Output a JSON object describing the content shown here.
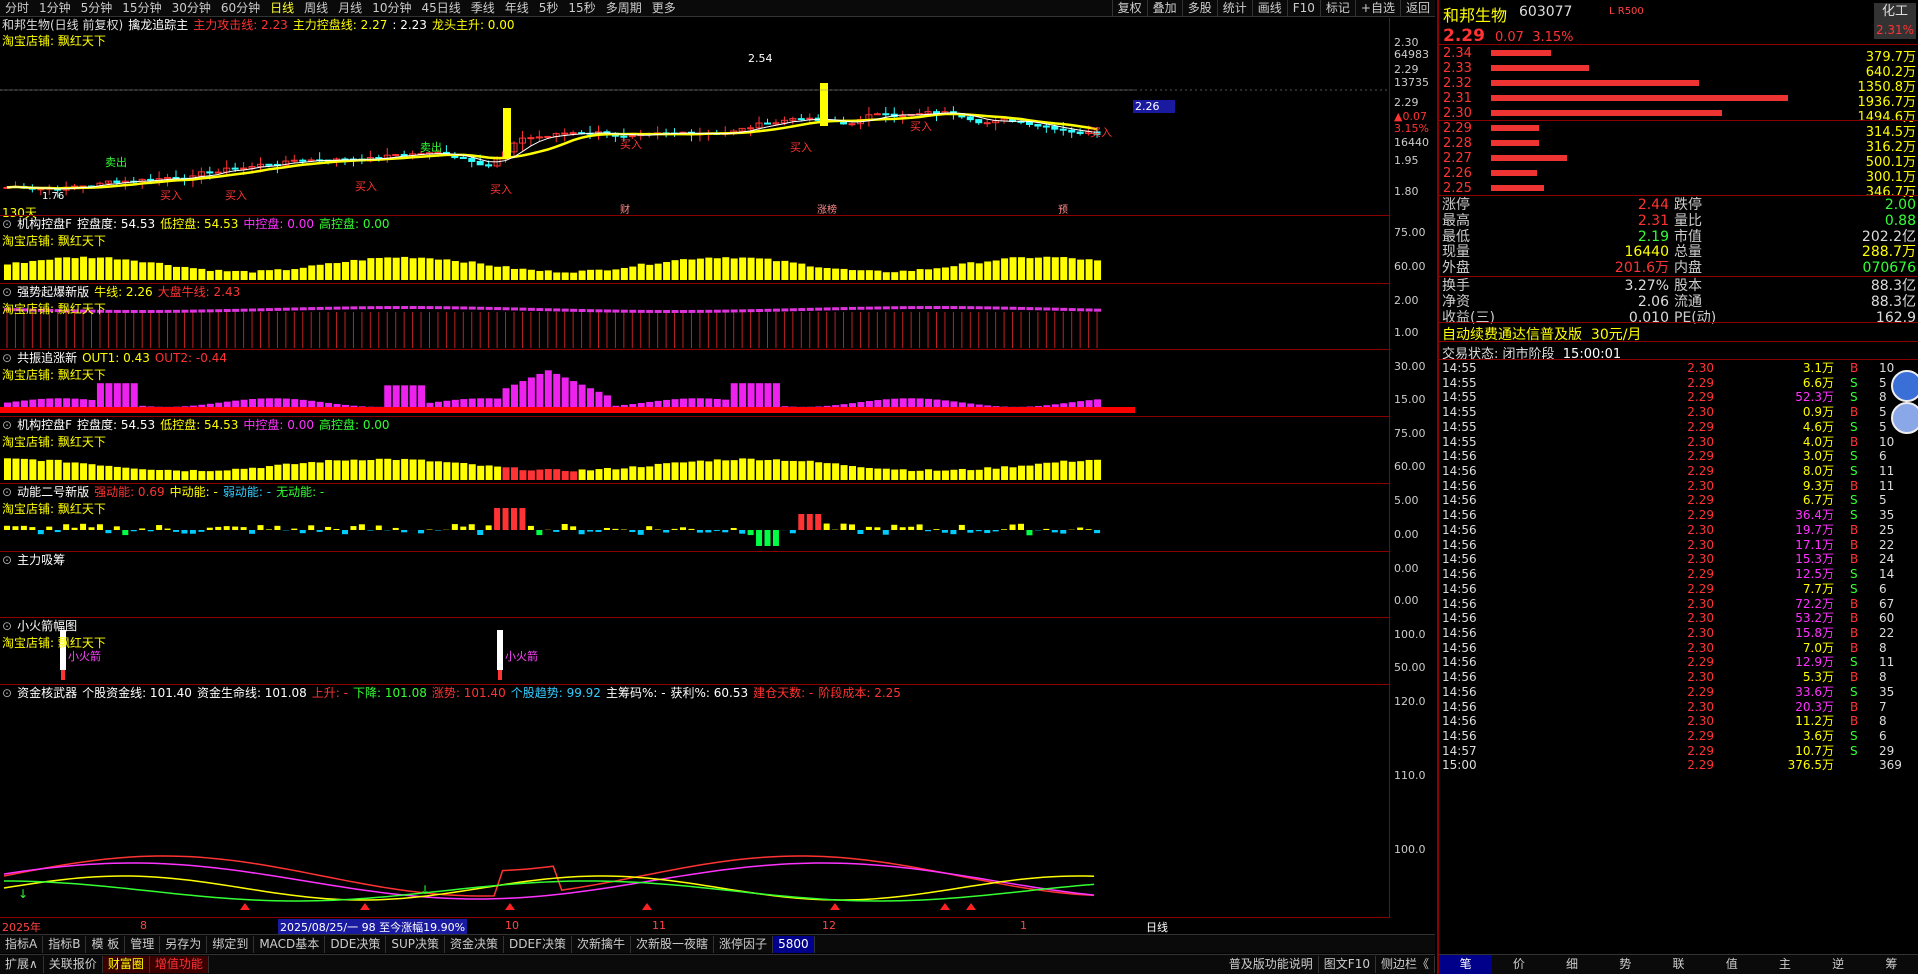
{
  "topbar": {
    "periods": [
      "分时",
      "1分钟",
      "5分钟",
      "15分钟",
      "30分钟",
      "60分钟",
      "日线",
      "周线",
      "月线",
      "10分钟",
      "45日线",
      "季线",
      "年线",
      "5秒",
      "15秒",
      "多周期",
      "更多"
    ],
    "active_period": "日线",
    "tools": [
      "复权",
      "叠加",
      "多股",
      "统计",
      "画线",
      "F10",
      "标记",
      "+自选",
      "返回"
    ]
  },
  "main": {
    "title": "和邦生物(日线 前复权)",
    "indicator": "擒龙追踪主",
    "fields": [
      {
        "label": "主力攻击线: 2.23",
        "color": "#ff3333"
      },
      {
        "label": "主力控盘线: 2.27",
        "color": "#ffff00"
      },
      {
        "label": ": 2.23",
        "color": "#ffffff"
      },
      {
        "label": "龙头主升: 0.00",
        "color": "#ffff00"
      }
    ],
    "note": "淘宝店铺: 飘红天下",
    "high_label": "2.54",
    "low_label": "1.76",
    "days_label": "130天",
    "price_tag": "2.26",
    "markers": [
      "卖出",
      "卖出",
      "买入",
      "买入",
      "买入",
      "买入",
      "买入",
      "买入",
      "买入",
      "买入"
    ],
    "event_tags": [
      "财",
      "涨榜",
      "预"
    ],
    "y_labels": [
      "2.30",
      "64983",
      "2.29",
      "13735",
      "2.29",
      "▲0.07",
      "3.15%",
      "16440",
      "1.95",
      "1.80"
    ]
  },
  "panels": [
    {
      "title": "机构控盘F",
      "fields": [
        {
          "label": "控盘度: 54.53",
          "color": "#ffffff"
        },
        {
          "label": "低控盘: 54.53",
          "color": "#ffff00"
        },
        {
          "label": "中控盘: 0.00",
          "color": "#ff33ff"
        },
        {
          "label": "高控盘: 0.00",
          "color": "#33ff33"
        }
      ],
      "note": "淘宝店铺: 飘红天下",
      "y": [
        "75.00",
        "60.00"
      ]
    },
    {
      "title": "强势起爆新版",
      "fields": [
        {
          "label": "牛线: 2.26",
          "color": "#ffff00"
        },
        {
          "label": "大盘牛线: 2.43",
          "color": "#ff3333"
        }
      ],
      "note": "淘宝店铺: 飘红天下",
      "y": [
        "2.00",
        "1.00"
      ]
    },
    {
      "title": "共振追涨新",
      "fields": [
        {
          "label": "OUT1: 0.43",
          "color": "#ffff00"
        },
        {
          "label": "OUT2: -0.44",
          "color": "#ff3333"
        }
      ],
      "note": "淘宝店铺: 飘红天下",
      "y": [
        "30.00",
        "15.00"
      ]
    },
    {
      "title": "机构控盘F",
      "fields": [
        {
          "label": "控盘度: 54.53",
          "color": "#ffffff"
        },
        {
          "label": "低控盘: 54.53",
          "color": "#ffff00"
        },
        {
          "label": "中控盘: 0.00",
          "color": "#ff33ff"
        },
        {
          "label": "高控盘: 0.00",
          "color": "#33ff33"
        }
      ],
      "note": "淘宝店铺: 飘红天下",
      "y": [
        "75.00",
        "60.00"
      ]
    },
    {
      "title": "动能二号新版",
      "fields": [
        {
          "label": "强动能: 0.69",
          "color": "#ff3333"
        },
        {
          "label": "中动能: -",
          "color": "#ffff00"
        },
        {
          "label": "弱动能: -",
          "color": "#33ccff"
        },
        {
          "label": "无动能: -",
          "color": "#33ff33"
        }
      ],
      "note": "淘宝店铺: 飘红天下",
      "y": [
        "5.00",
        "0.00"
      ]
    },
    {
      "title": "主力吸筹",
      "fields": [],
      "note": "",
      "y": [
        "0.00",
        "0.00"
      ]
    },
    {
      "title": "小火箭幅图",
      "fields": [],
      "note": "淘宝店铺: 飘红天下",
      "y": [
        "100.0",
        "50.00"
      ],
      "rocket": "小火箭"
    },
    {
      "title": "资金核武器",
      "fields": [
        {
          "label": "个股资金线: 101.40",
          "color": "#ffffff"
        },
        {
          "label": "资金生命线: 101.08",
          "color": "#ffffff"
        },
        {
          "label": "上升: -",
          "color": "#ff3333"
        },
        {
          "label": "下降: 101.08",
          "color": "#33ff33"
        },
        {
          "label": "涨势: 101.40",
          "color": "#ff3333"
        },
        {
          "label": "个股趋势: 99.92",
          "color": "#33ccff"
        },
        {
          "label": "主筹码%: -",
          "color": "#ffffff"
        },
        {
          "label": "获利%: 60.53",
          "color": "#ffffff"
        },
        {
          "label": "建仓天数: -",
          "color": "#ff3333"
        },
        {
          "label": "阶段成本: 2.25",
          "color": "#ff3333"
        }
      ],
      "note": "",
      "y": [
        "120.0",
        "110.0",
        "100.0"
      ]
    }
  ],
  "datebar": {
    "labels": [
      "2025年",
      "8",
      "10",
      "11",
      "12",
      "1"
    ],
    "highlight": "2025/08/25/一 98 至今涨幅19.90%",
    "right": "日线"
  },
  "bottombar1": [
    "指标A",
    "指标B",
    "模 板",
    "管理",
    "另存为",
    "绑定到",
    "MACD基本",
    "DDE决策",
    "SUP决策",
    "资金决策",
    "DDEF决策",
    "次新擒牛",
    "次新股一夜瞎",
    "涨停因子",
    "5800"
  ],
  "bottombar2": [
    "扩展∧",
    "关联报价",
    "财富圈",
    "增值功能"
  ],
  "bottom_right": [
    "普及版功能说明",
    "图文F10",
    "侧边栏《"
  ],
  "stock": {
    "name": "和邦生物",
    "code": "603077",
    "tag": "L R500",
    "price": "2.29",
    "change": "0.07",
    "pct": "3.15%",
    "industry": "化工",
    "industry_pct": "2.31%"
  },
  "asks": [
    {
      "p": "2.34",
      "v": "379.7万",
      "w": 72
    },
    {
      "p": "2.33",
      "v": "640.2万",
      "w": 118
    },
    {
      "p": "2.32",
      "v": "1350.8万",
      "w": 250
    },
    {
      "p": "2.31",
      "v": "1936.7万",
      "w": 358
    },
    {
      "p": "2.30",
      "v": "1494.6万",
      "w": 278
    }
  ],
  "bids": [
    {
      "p": "2.29",
      "v": "314.5万",
      "w": 58
    },
    {
      "p": "2.28",
      "v": "316.2万",
      "w": 58
    },
    {
      "p": "2.27",
      "v": "500.1万",
      "w": 92
    },
    {
      "p": "2.26",
      "v": "300.1万",
      "w": 55
    },
    {
      "p": "2.25",
      "v": "346.7万",
      "w": 64
    }
  ],
  "stats": [
    {
      "k1": "涨停",
      "v1": "2.44",
      "c1": "#ff3333",
      "k2": "跌停",
      "v2": "2.00",
      "c2": "#33ff33"
    },
    {
      "k1": "最高",
      "v1": "2.31",
      "c1": "#ff3333",
      "k2": "量比",
      "v2": "0.88",
      "c2": "#33ff33"
    },
    {
      "k1": "最低",
      "v1": "2.19",
      "c1": "#33ff33",
      "k2": "市值",
      "v2": "202.2亿",
      "c2": "#dddddd"
    },
    {
      "k1": "现量",
      "v1": "16440",
      "c1": "#ffff00",
      "k2": "总量",
      "v2": "288.7万",
      "c2": "#ffff00"
    },
    {
      "k1": "外盘",
      "v1": "201.6万",
      "c1": "#ff3333",
      "k2": "内盘",
      "v2": "070676",
      "c2": "#33ff33"
    },
    {
      "k1": "换手",
      "v1": "3.27%",
      "c1": "#dddddd",
      "k2": "股本",
      "v2": "88.3亿",
      "c2": "#dddddd"
    },
    {
      "k1": "净资",
      "v1": "2.06",
      "c1": "#dddddd",
      "k2": "流通",
      "v2": "88.3亿",
      "c2": "#dddddd"
    },
    {
      "k1": "收益(三)",
      "v1": "0.010",
      "c1": "#dddddd",
      "k2": "PE(动)",
      "v2": "162.9",
      "c2": "#dddddd"
    }
  ],
  "promo": {
    "text": "自动续费通达信普及版",
    "price": "30元/月"
  },
  "trade_status": {
    "label": "交易状态: 闭市阶段",
    "time": "15:00:01"
  },
  "ticks": [
    {
      "t": "14:55",
      "p": "2.30",
      "v": "3.1万",
      "vc": "#ffff00",
      "bs": "B",
      "n": "10"
    },
    {
      "t": "14:55",
      "p": "2.29",
      "v": "6.6万",
      "vc": "#ffff00",
      "bs": "S",
      "n": "5"
    },
    {
      "t": "14:55",
      "p": "2.29",
      "v": "52.3万",
      "vc": "#ff33ff",
      "bs": "S",
      "n": "8"
    },
    {
      "t": "14:55",
      "p": "2.30",
      "v": "0.9万",
      "vc": "#ffff00",
      "bs": "B",
      "n": "5"
    },
    {
      "t": "14:55",
      "p": "2.29",
      "v": "4.6万",
      "vc": "#ffff00",
      "bs": "S",
      "n": "5"
    },
    {
      "t": "14:55",
      "p": "2.30",
      "v": "4.0万",
      "vc": "#ffff00",
      "bs": "B",
      "n": "10"
    },
    {
      "t": "14:56",
      "p": "2.29",
      "v": "3.0万",
      "vc": "#ffff00",
      "bs": "S",
      "n": "6"
    },
    {
      "t": "14:56",
      "p": "2.29",
      "v": "8.0万",
      "vc": "#ffff00",
      "bs": "S",
      "n": "11"
    },
    {
      "t": "14:56",
      "p": "2.30",
      "v": "9.3万",
      "vc": "#ffff00",
      "bs": "B",
      "n": "11"
    },
    {
      "t": "14:56",
      "p": "2.29",
      "v": "6.7万",
      "vc": "#ffff00",
      "bs": "S",
      "n": "5"
    },
    {
      "t": "14:56",
      "p": "2.29",
      "v": "36.4万",
      "vc": "#ff33ff",
      "bs": "S",
      "n": "35"
    },
    {
      "t": "14:56",
      "p": "2.30",
      "v": "19.7万",
      "vc": "#ff33ff",
      "bs": "B",
      "n": "25"
    },
    {
      "t": "14:56",
      "p": "2.30",
      "v": "17.1万",
      "vc": "#ff33ff",
      "bs": "B",
      "n": "22"
    },
    {
      "t": "14:56",
      "p": "2.30",
      "v": "15.3万",
      "vc": "#ff33ff",
      "bs": "B",
      "n": "24"
    },
    {
      "t": "14:56",
      "p": "2.29",
      "v": "12.5万",
      "vc": "#ff33ff",
      "bs": "S",
      "n": "14"
    },
    {
      "t": "14:56",
      "p": "2.29",
      "v": "7.7万",
      "vc": "#ffff00",
      "bs": "S",
      "n": "6"
    },
    {
      "t": "14:56",
      "p": "2.30",
      "v": "72.2万",
      "vc": "#ff33ff",
      "bs": "B",
      "n": "67"
    },
    {
      "t": "14:56",
      "p": "2.30",
      "v": "53.2万",
      "vc": "#ff33ff",
      "bs": "B",
      "n": "60"
    },
    {
      "t": "14:56",
      "p": "2.30",
      "v": "15.8万",
      "vc": "#ff33ff",
      "bs": "B",
      "n": "22"
    },
    {
      "t": "14:56",
      "p": "2.30",
      "v": "7.0万",
      "vc": "#ffff00",
      "bs": "B",
      "n": "8"
    },
    {
      "t": "14:56",
      "p": "2.29",
      "v": "12.9万",
      "vc": "#ff33ff",
      "bs": "S",
      "n": "11"
    },
    {
      "t": "14:56",
      "p": "2.30",
      "v": "5.3万",
      "vc": "#ffff00",
      "bs": "B",
      "n": "8"
    },
    {
      "t": "14:56",
      "p": "2.29",
      "v": "33.6万",
      "vc": "#ff33ff",
      "bs": "S",
      "n": "35"
    },
    {
      "t": "14:56",
      "p": "2.30",
      "v": "20.3万",
      "vc": "#ff33ff",
      "bs": "B",
      "n": "7"
    },
    {
      "t": "14:56",
      "p": "2.30",
      "v": "11.2万",
      "vc": "#ffff00",
      "bs": "B",
      "n": "8"
    },
    {
      "t": "14:56",
      "p": "2.29",
      "v": "3.6万",
      "vc": "#ffff00",
      "bs": "S",
      "n": "6"
    },
    {
      "t": "14:57",
      "p": "2.29",
      "v": "10.7万",
      "vc": "#ffff00",
      "bs": "S",
      "n": "29"
    },
    {
      "t": "15:00",
      "p": "2.29",
      "v": "376.5万",
      "vc": "#ffff00",
      "bs": "",
      "n": "369"
    }
  ],
  "rp_tabs": [
    "笔",
    "价",
    "细",
    "势",
    "联",
    "值",
    "主",
    "逆",
    "筹"
  ]
}
